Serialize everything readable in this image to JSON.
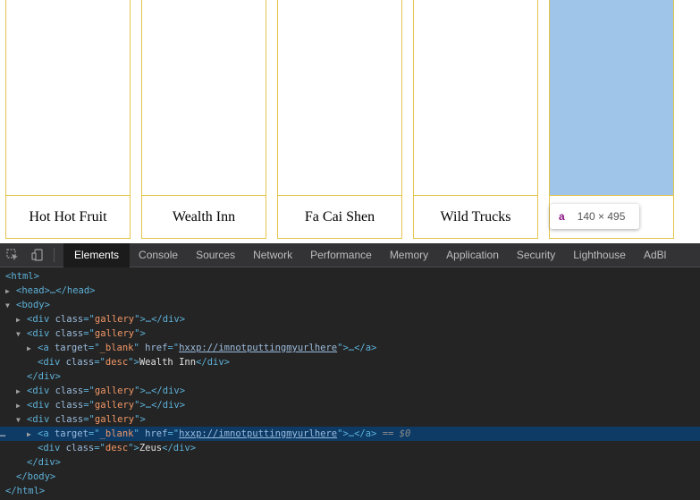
{
  "gallery": [
    {
      "desc": "Hot Hot Fruit"
    },
    {
      "desc": "Wealth Inn"
    },
    {
      "desc": "Fa Cai Shen"
    },
    {
      "desc": "Wild Trucks"
    }
  ],
  "tooltip": {
    "tag": "a",
    "dims": "140 × 495"
  },
  "devtools": {
    "tabs": [
      "Elements",
      "Console",
      "Sources",
      "Network",
      "Performance",
      "Memory",
      "Application",
      "Security",
      "Lighthouse",
      "AdBl"
    ],
    "active_tab": "Elements",
    "tree": {
      "html_open": "<html>",
      "head": "<head>…</head>",
      "body_open": "<body>",
      "gallery_collapsed": "<div class=\"gallery\">…</div>",
      "gallery_open": "<div class=\"gallery\">",
      "anchor_collapsed": "<a target=\"_blank\" href=\"hxxp://imnotputtingmyurlhere\">…</a>",
      "href": "hxxp://imnotputtingmyurlhere",
      "desc_text_1": "Wealth Inn",
      "desc_text_2": "Zeus",
      "div_close": "</div>",
      "body_close": "</body>",
      "html_close": "</html>",
      "selected_marker": "== $0"
    }
  }
}
